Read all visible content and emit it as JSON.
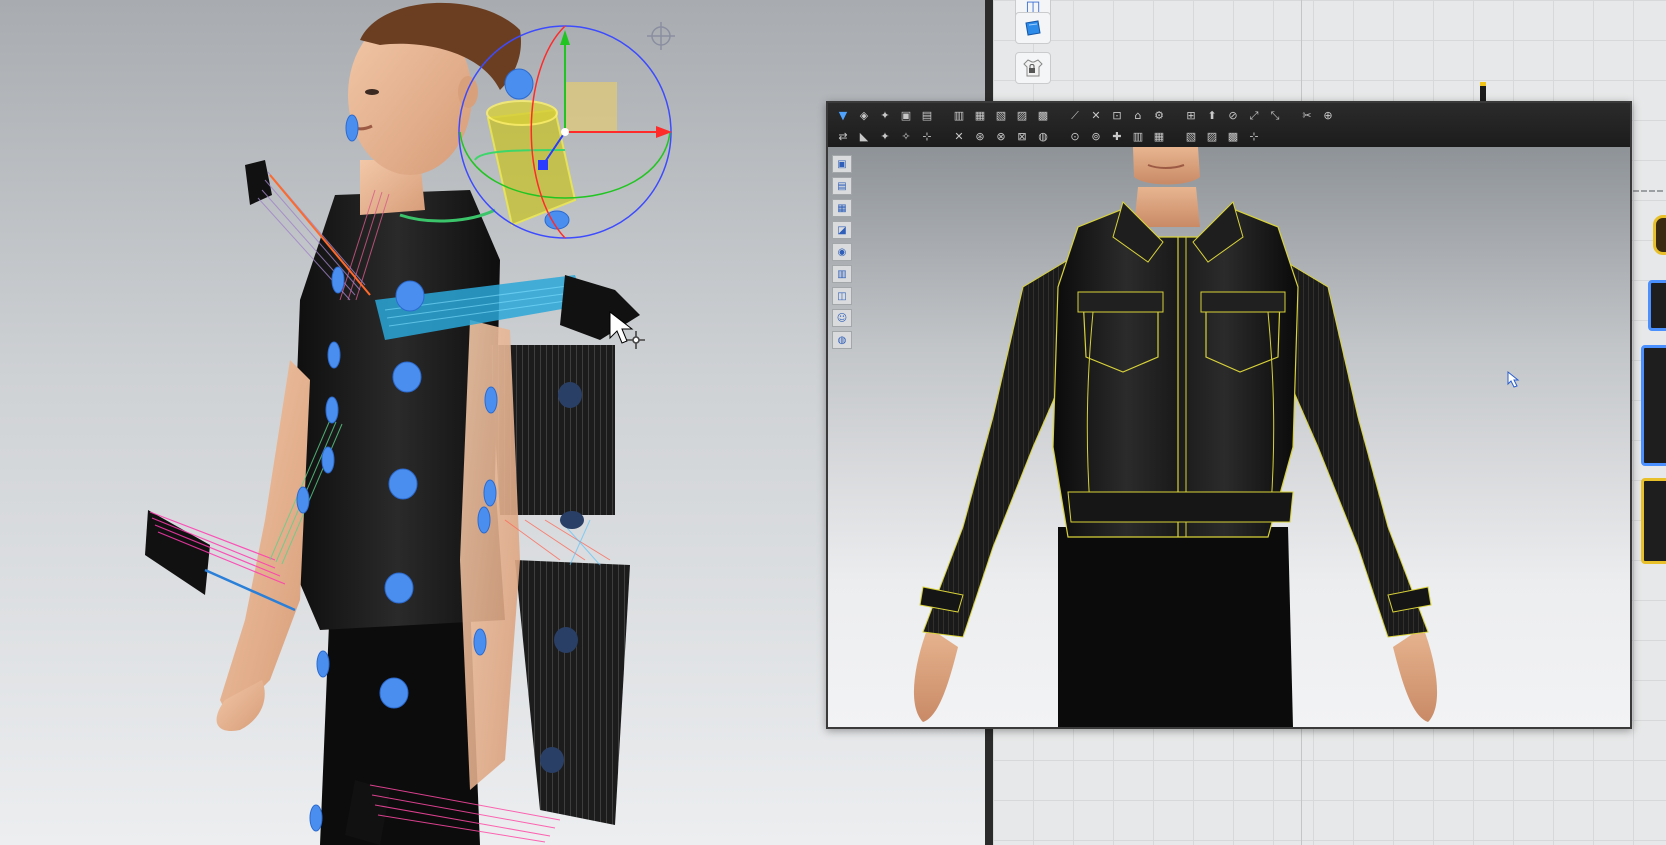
{
  "viewport": {
    "background_top": "#a8acb0",
    "background_bottom": "#eceef0",
    "gizmo_colors": {
      "x_axis": "#ff2a2a",
      "y_axis": "#21c521",
      "z_axis": "#2a3cff"
    },
    "point_color": "#4a8ff0"
  },
  "pattern_window": {
    "tools": [
      {
        "icon": "sheet-icon"
      },
      {
        "icon": "shirt-lock-icon"
      }
    ],
    "piece_outline_color": "#4a90ff"
  },
  "sim_window": {
    "toolbar_row1": [
      "▼",
      "◈",
      "✦",
      "▣",
      "▤",
      "▥",
      "▦",
      "▧",
      "▨",
      "▩",
      "⟋",
      "✕",
      "⊡",
      "⌂",
      "⚙",
      "⊞",
      "⬆",
      "⊘",
      "⤢",
      "⤡",
      "✂",
      "⊕"
    ],
    "toolbar_row2": [
      "⇄",
      "◣",
      "✦",
      "✧",
      "⊹",
      "✕",
      "⊛",
      "⊗",
      "⊠",
      "◍",
      "⊙",
      "⊚",
      "✚",
      "▥",
      "▦",
      "▧",
      "▨",
      "▩",
      "⊹"
    ],
    "side_tools": [
      "▣",
      "▤",
      "▦",
      "◪",
      "◉",
      "▥",
      "◫",
      "☺",
      "◍"
    ],
    "jacket_color": "#121212",
    "seam_color": "#d8d23a"
  }
}
